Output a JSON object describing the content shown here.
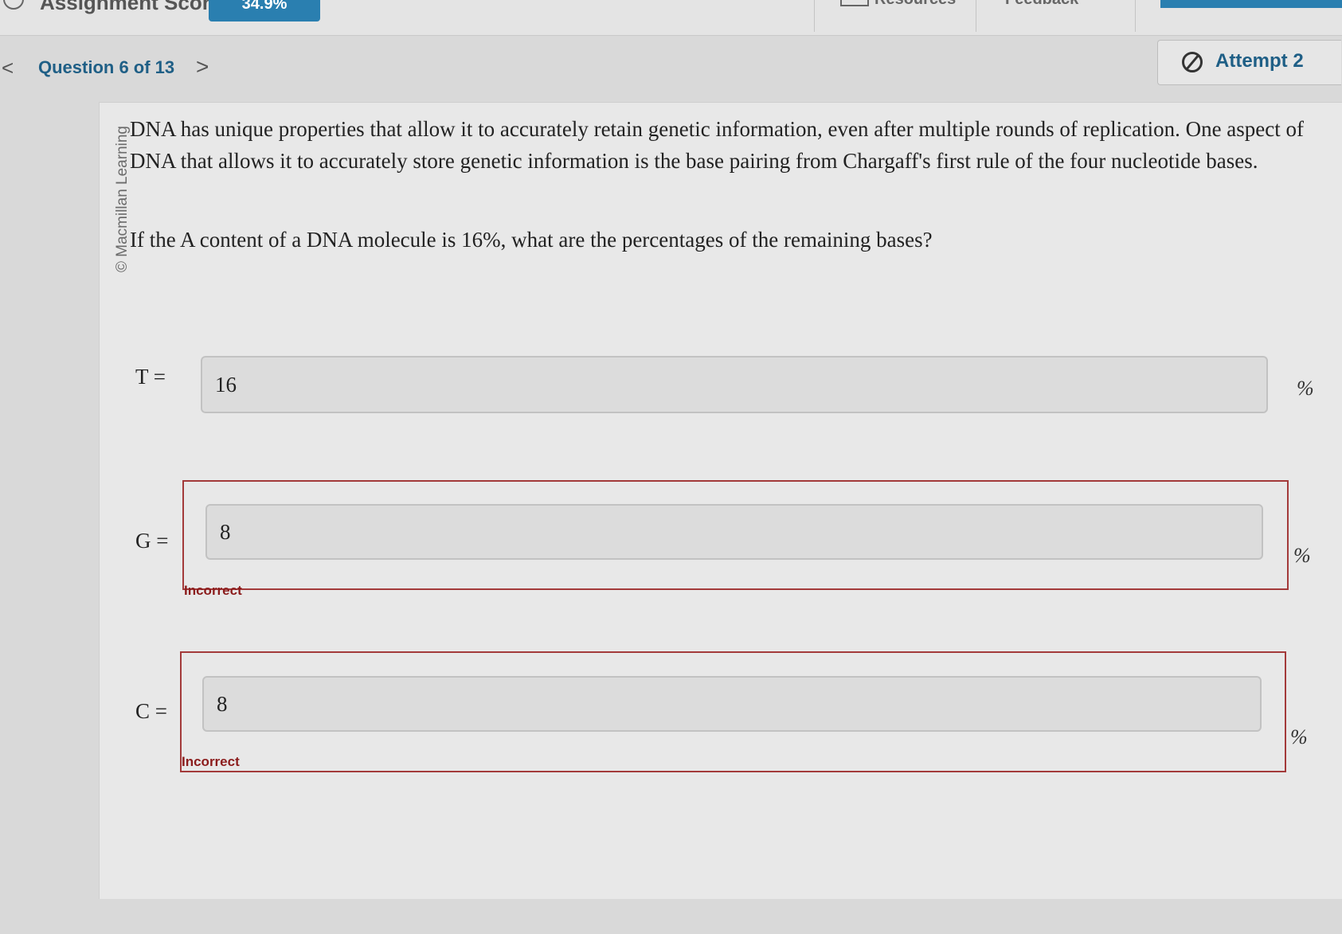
{
  "header": {
    "score_label": "Assignment Score:",
    "score_value": "34.9%",
    "resources_label": "Resources",
    "feedback_label": "Feedback"
  },
  "nav": {
    "question_label": "Question 6 of 13",
    "prev_glyph": "<",
    "next_glyph": ">"
  },
  "attempt": {
    "label": "Attempt 2"
  },
  "question": {
    "copyright": "© Macmillan Learning",
    "paragraph": "DNA has unique properties that allow it to accurately retain genetic information, even after multiple rounds of replication. One aspect of DNA that allows it to accurately store genetic information is the base pairing from Chargaff's first rule of the four nucleotide bases.",
    "prompt": "If the A content of a DNA molecule is 16%, what are the percentages of the remaining bases?"
  },
  "answers": {
    "t": {
      "label": "T =",
      "value": "16",
      "unit": "%"
    },
    "g": {
      "label": "G =",
      "value": "8",
      "unit": "%",
      "feedback": "Incorrect"
    },
    "c": {
      "label": "C =",
      "value": "8",
      "unit": "%",
      "feedback": "Incorrect"
    }
  },
  "colors": {
    "accent": "#2a7fb0",
    "nav_text": "#1f5f86",
    "incorrect": "#a33a3a"
  }
}
